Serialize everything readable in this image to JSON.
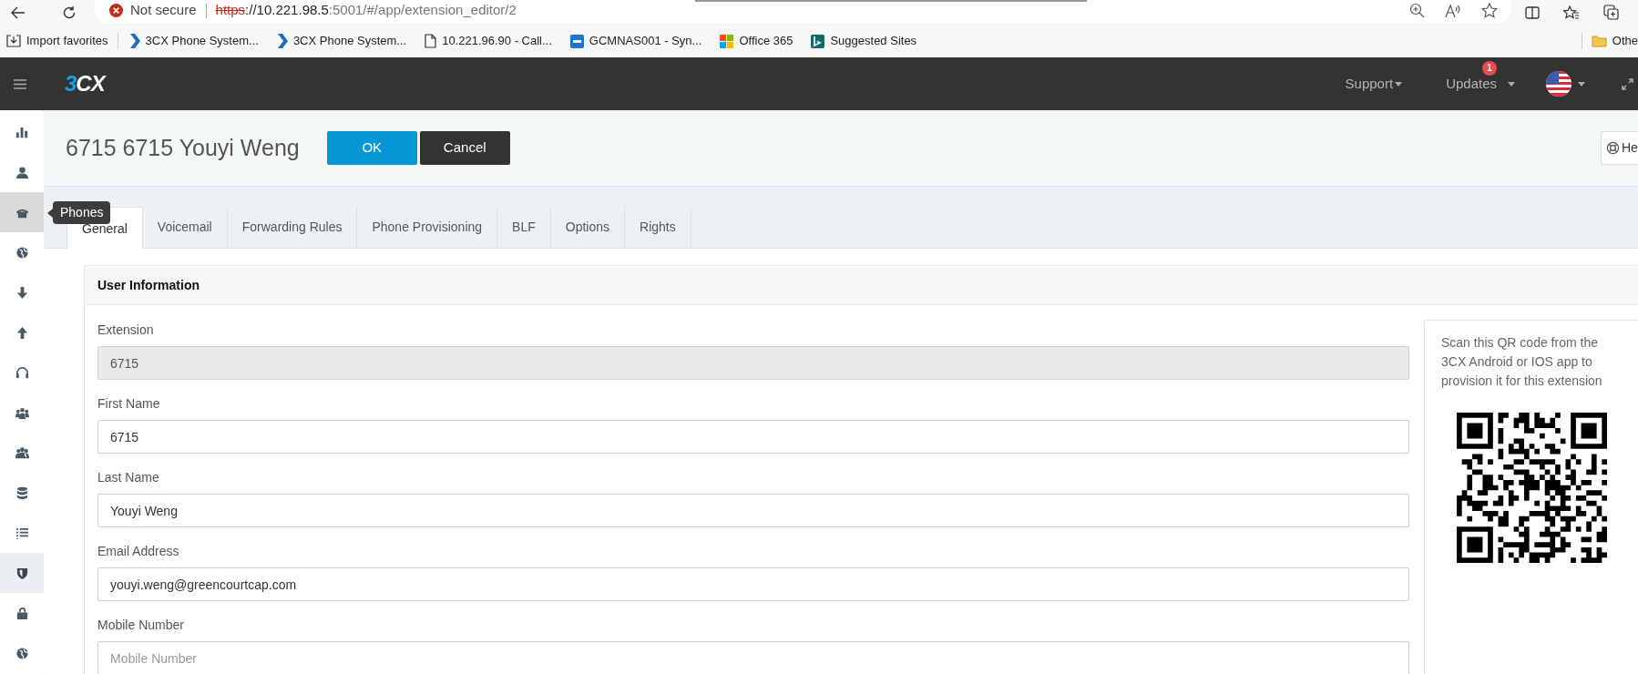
{
  "browser": {
    "security": "Not secure",
    "url": {
      "scheme": "https",
      "host": "://10.221.98.5",
      "path": ":5001/#/app/extension_editor/2"
    },
    "bookmarks": [
      {
        "kind": "import",
        "label": "Import favorites"
      },
      {
        "kind": "chevron",
        "label": "3CX Phone System..."
      },
      {
        "kind": "chevron",
        "label": "3CX Phone System..."
      },
      {
        "kind": "page",
        "label": "10.221.96.90 - Call..."
      },
      {
        "kind": "dsm",
        "label": "GCMNAS001 - Syn..."
      },
      {
        "kind": "squares",
        "label": "Office 365"
      },
      {
        "kind": "bing",
        "label": "Suggested Sites"
      }
    ],
    "other_favorites": "Othe"
  },
  "app_header": {
    "logo": {
      "accent": "3",
      "rest": "CX"
    },
    "menus": [
      {
        "label": "Support"
      },
      {
        "label": "Updates",
        "badge": "1"
      }
    ]
  },
  "sidebar": {
    "items": [
      {
        "kind": "chart",
        "selected": false,
        "highlighted": false
      },
      {
        "kind": "user",
        "selected": false,
        "highlighted": false
      },
      {
        "kind": "phone",
        "selected": true,
        "highlighted": false,
        "tooltip": "Phones"
      },
      {
        "kind": "globe",
        "selected": false,
        "highlighted": false
      },
      {
        "kind": "down",
        "selected": false,
        "highlighted": false
      },
      {
        "kind": "up",
        "selected": false,
        "highlighted": false
      },
      {
        "kind": "headset",
        "selected": false,
        "highlighted": false
      },
      {
        "kind": "group",
        "selected": false,
        "highlighted": false
      },
      {
        "kind": "users",
        "selected": false,
        "highlighted": false
      },
      {
        "kind": "database",
        "selected": false,
        "highlighted": false
      },
      {
        "kind": "list",
        "selected": false,
        "highlighted": false
      },
      {
        "kind": "shield",
        "selected": false,
        "highlighted": true
      },
      {
        "kind": "lock",
        "selected": false,
        "highlighted": false
      },
      {
        "kind": "globe",
        "selected": false,
        "highlighted": false
      }
    ]
  },
  "page": {
    "title": "6715 6715 Youyi Weng",
    "buttons": [
      {
        "kind": "primary",
        "label": "OK"
      },
      {
        "kind": "dark",
        "label": "Cancel"
      }
    ],
    "help": "He"
  },
  "tabs": [
    {
      "label": "General",
      "selected": true
    },
    {
      "label": "Voicemail",
      "selected": false
    },
    {
      "label": "Forwarding Rules",
      "selected": false
    },
    {
      "label": "Phone Provisioning",
      "selected": false
    },
    {
      "label": "BLF",
      "selected": false
    },
    {
      "label": "Options",
      "selected": false
    },
    {
      "label": "Rights",
      "selected": false
    }
  ],
  "panel": {
    "title": "User Information",
    "fields": [
      {
        "label": "Extension",
        "value": "6715",
        "disabled": true
      },
      {
        "label": "First Name",
        "value": "6715",
        "disabled": false
      },
      {
        "label": "Last Name",
        "value": "Youyi Weng",
        "disabled": false
      },
      {
        "label": "Email Address",
        "value": "youyi.weng@greencourtcap.com",
        "disabled": false
      },
      {
        "label": "Mobile Number",
        "placeholder": "Mobile Number",
        "disabled": false
      }
    ],
    "qr": {
      "text": "Scan this QR code from the 3CX Android or IOS app to provision it for this extension"
    }
  }
}
